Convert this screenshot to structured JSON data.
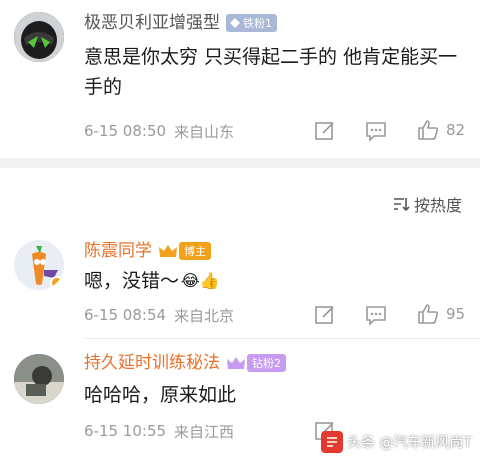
{
  "comments": [
    {
      "username": "极恶贝利亚增强型",
      "badge": "铁粉1",
      "text": "意思是你太穷 只买得起二手的 他肯定能买一手的",
      "date": "6-15 08:50",
      "location": "来自山东",
      "likes": "82",
      "emoji": ""
    },
    {
      "username": "陈震同学",
      "badge": "博主",
      "text": "嗯，没错～",
      "date": "6-15 08:54",
      "location": "来自北京",
      "likes": "95",
      "emoji": "😂👍"
    },
    {
      "username": "持久延时训练秘法",
      "badge": "钻粉2",
      "text": "哈哈哈，原来如此",
      "date": "6-15 10:55",
      "location": "来自江西",
      "likes": "",
      "emoji": ""
    }
  ],
  "sort": {
    "label": "按热度"
  },
  "watermark": {
    "text": "头条 @汽车新风尚T"
  },
  "colors": {
    "iron_badge": "#a9b8d6",
    "host_badge": "#f0a31a",
    "diamond_badge": "#c79cf0",
    "host_name": "#e8722a"
  }
}
